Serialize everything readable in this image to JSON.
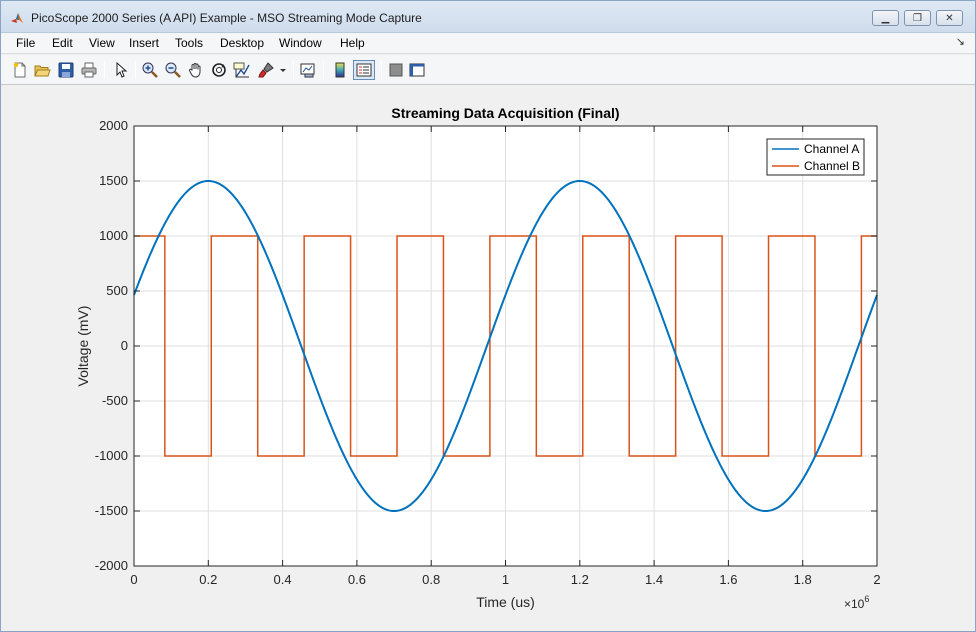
{
  "window": {
    "title": "PicoScope 2000 Series (A API) Example - MSO Streaming Mode Capture",
    "buttons": {
      "minimize": "▁",
      "restore": "❐",
      "close": "✕"
    }
  },
  "menu": {
    "items": [
      "File",
      "Edit",
      "View",
      "Insert",
      "Tools",
      "Desktop",
      "Window",
      "Help"
    ],
    "overflow": "↘"
  },
  "toolbar": {
    "icons": [
      "new-figure-icon",
      "open-file-icon",
      "save-icon",
      "print-icon",
      "select-arrow-icon",
      "zoom-in-icon",
      "zoom-out-icon",
      "pan-hand-icon",
      "rotate-3d-icon",
      "data-cursor-icon",
      "brush-icon",
      "brush-dropdown-icon",
      "link-plot-icon",
      "colorbar-icon",
      "legend-icon",
      "hide-plot-tools-icon",
      "show-plot-tools-icon"
    ]
  },
  "colors": {
    "channel_a": "#0072bd",
    "channel_b": "#d95319",
    "grid": "#dfdfdf",
    "axes": "#262626"
  },
  "chart_data": {
    "type": "line",
    "title": "Streaming Data Acquisition (Final)",
    "xlabel": "Time (us)",
    "ylabel": "Voltage (mV)",
    "x_exponent_label": "×10",
    "x_exponent_power": "6",
    "xlim": [
      0,
      2000000
    ],
    "ylim": [
      -2000,
      2000
    ],
    "xticks": [
      0,
      200000,
      400000,
      600000,
      800000,
      1000000,
      1200000,
      1400000,
      1600000,
      1800000,
      2000000
    ],
    "xtick_labels": [
      "0",
      "0.2",
      "0.4",
      "0.6",
      "0.8",
      "1",
      "1.2",
      "1.4",
      "1.6",
      "1.8",
      "2"
    ],
    "yticks": [
      -2000,
      -1500,
      -1000,
      -500,
      0,
      500,
      1000,
      1500,
      2000
    ],
    "ytick_labels": [
      "-2000",
      "-1500",
      "-1000",
      "-500",
      "0",
      "500",
      "1000",
      "1500",
      "2000"
    ],
    "grid": true,
    "legend_position": "top-right",
    "series": [
      {
        "name": "Channel A",
        "shape": "sine",
        "amplitude": 1500,
        "period": 1000000,
        "offset": 0,
        "x": [
          0,
          50000,
          100000,
          150000,
          200000,
          250000,
          300000,
          350000,
          400000,
          450000,
          500000,
          550000,
          600000,
          650000,
          700000,
          750000,
          800000,
          850000,
          900000,
          950000,
          1000000,
          1050000,
          1100000,
          1150000,
          1200000,
          1250000,
          1300000,
          1350000,
          1400000,
          1450000,
          1500000,
          1550000,
          1600000,
          1650000,
          1700000,
          1750000,
          1800000,
          1850000,
          1900000,
          1950000,
          2000000
        ],
        "y": [
          464,
          882,
          1214,
          1427,
          1500,
          1427,
          1214,
          882,
          464,
          0,
          -464,
          -882,
          -1214,
          -1427,
          -1500,
          -1427,
          -1214,
          -882,
          -464,
          0,
          464,
          882,
          1214,
          1427,
          1500,
          1427,
          1214,
          882,
          464,
          0,
          -464,
          -882,
          -1214,
          -1427,
          -1500,
          -1427,
          -1214,
          -882,
          -464,
          0,
          464
        ]
      },
      {
        "name": "Channel B",
        "shape": "square",
        "x": [
          0,
          83000,
          83000,
          208000,
          208000,
          333000,
          333000,
          458000,
          458000,
          583000,
          583000,
          708000,
          708000,
          833000,
          833000,
          958000,
          958000,
          1083000,
          1083000,
          1208000,
          1208000,
          1333000,
          1333000,
          1458000,
          1458000,
          1583000,
          1583000,
          1708000,
          1708000,
          1833000,
          1833000,
          1958000,
          1958000,
          2000000
        ],
        "y": [
          1000,
          1000,
          -1000,
          -1000,
          1000,
          1000,
          -1000,
          -1000,
          1000,
          1000,
          -1000,
          -1000,
          1000,
          1000,
          -1000,
          -1000,
          1000,
          1000,
          -1000,
          -1000,
          1000,
          1000,
          -1000,
          -1000,
          1000,
          1000,
          -1000,
          -1000,
          1000,
          1000,
          -1000,
          -1000,
          1000,
          1000
        ]
      }
    ]
  }
}
